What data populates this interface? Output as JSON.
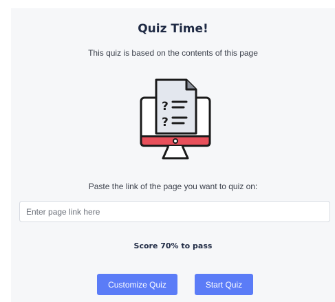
{
  "quiz": {
    "title": "Quiz Time!",
    "subtitle": "This quiz is based on the contents of this page",
    "illustration_icon": "monitor-quiz-icon",
    "prompt": "Paste the link of the page you want to quiz on:",
    "link_input": {
      "value": "",
      "placeholder": "Enter page link here"
    },
    "score_text": "Score 70% to pass",
    "buttons": {
      "customize_label": "Customize Quiz",
      "start_label": "Start Quiz"
    }
  },
  "colors": {
    "panel_bg": "#f6f7f9",
    "title": "#1f2a44",
    "button_bg": "#5b7cf7",
    "monitor_stand_red": "#e8505b",
    "document_bg": "#e3e7ee"
  }
}
